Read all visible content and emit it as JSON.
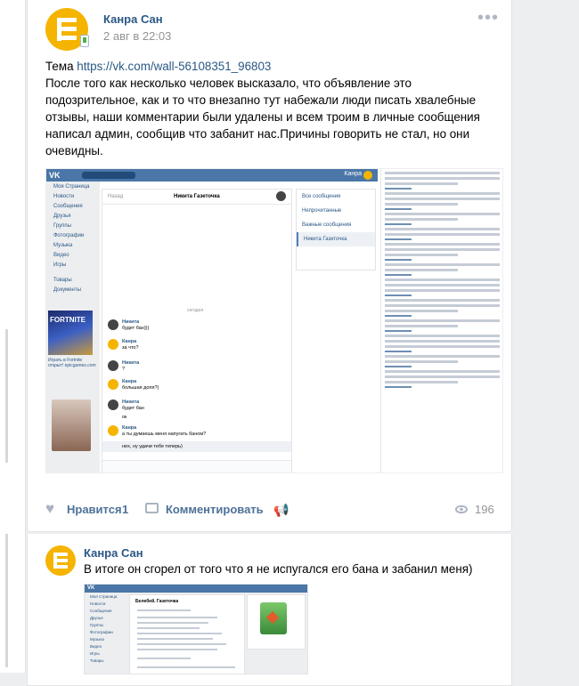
{
  "post": {
    "author": "Канра Сан",
    "date": "2 авг в 22:03",
    "text_prefix": "Тема ",
    "link": "https://vk.com/wall-56108351_96803",
    "text_body": "После того как несколько человек высказало, что объявление это подозрительное, как и то что внезапно тут набежали люди писать хвалебные отзывы, наши комментарии были удалены и всем троим в личные сообщения написал админ, сообщив что забанит нас.Причины говорить не стал, но они очевидны.",
    "actions": {
      "like_label": "Нравится",
      "like_count": "1",
      "comment_label": "Комментировать",
      "views": "196"
    }
  },
  "screenshot1": {
    "header_user": "Канра",
    "sidebar": [
      "Моя Страница",
      "Новости",
      "Сообщения",
      "Друзья",
      "Группы",
      "Фотографии",
      "Музыка",
      "Видео",
      "Игры",
      "Товары",
      "Документы"
    ],
    "ad1_title": "FORTNITE",
    "ad1_caption": "Играть в Fortnite открыт! epicgames.com",
    "chat": {
      "back": "Назад",
      "title": "Никита Газеточка",
      "day": "сегодня",
      "messages": [
        {
          "name": "Никита",
          "text": "будет бан)))"
        },
        {
          "name": "Канра",
          "text": "за что?"
        },
        {
          "name": "Никита",
          "text": "?"
        },
        {
          "name": "Канра",
          "text": "большая доля?)"
        },
        {
          "name": "Никита",
          "text": "будет бан"
        },
        {
          "name": "Канра",
          "text": "а ты думаешь меня напугать баном?"
        }
      ],
      "plain_line": "ок",
      "last_line": "нeх, ну удачи тебе теперь)"
    },
    "right_menu": [
      "Все сообщения",
      "Непрочитанные",
      "Важные сообщения",
      "Никита Газеточка"
    ]
  },
  "comment": {
    "author": "Канра Сан",
    "text": "В итоге он сгорел от того что я не испугался его бана и забанил меня)"
  },
  "screenshot2": {
    "logo": "VK",
    "sidebar": [
      "Моя Страница",
      "Новости",
      "Сообщения",
      "Друзья",
      "Группы",
      "Фотографии",
      "Музыка",
      "Видео",
      "Игры",
      "Товары"
    ],
    "title": "Белебей. Газеточка"
  }
}
